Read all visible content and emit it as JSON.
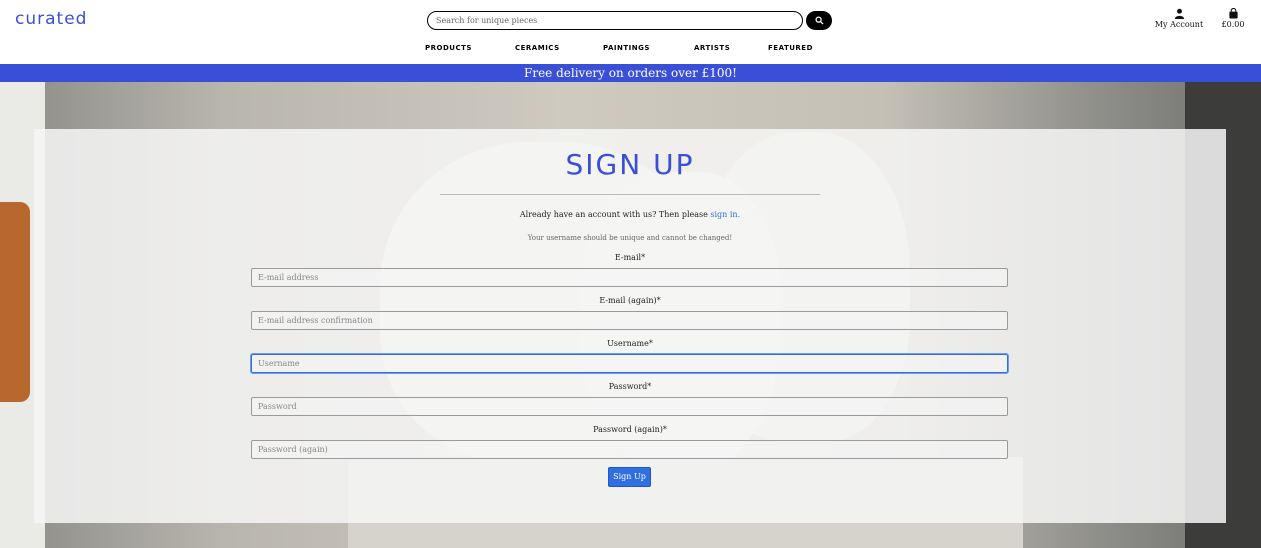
{
  "header": {
    "logo": "curated",
    "search": {
      "placeholder": "Search for unique pieces"
    },
    "account_label": "My Account",
    "cart_label": "£0.00",
    "nav": [
      "products",
      "ceramics",
      "paintings",
      "artists",
      "featured"
    ]
  },
  "banner": {
    "text": "Free delivery on orders over £100!"
  },
  "form": {
    "title": "SIGN UP",
    "already_prefix": "Already have an account with us? Then please ",
    "already_link": "sign in.",
    "username_note": "Your username should be unique and cannot be changed!",
    "fields": [
      {
        "label": "E-mail*",
        "placeholder": "E-mail address"
      },
      {
        "label": "E-mail (again)*",
        "placeholder": "E-mail address confirmation"
      },
      {
        "label": "Username*",
        "placeholder": "Username"
      },
      {
        "label": "Password*",
        "placeholder": "Password"
      },
      {
        "label": "Password (again)*",
        "placeholder": "Password (again)"
      }
    ],
    "submit_label": "Sign Up"
  },
  "colors": {
    "brand": "#3a4fd8",
    "link": "#2f6fe0",
    "button": "#2f6fe0"
  }
}
